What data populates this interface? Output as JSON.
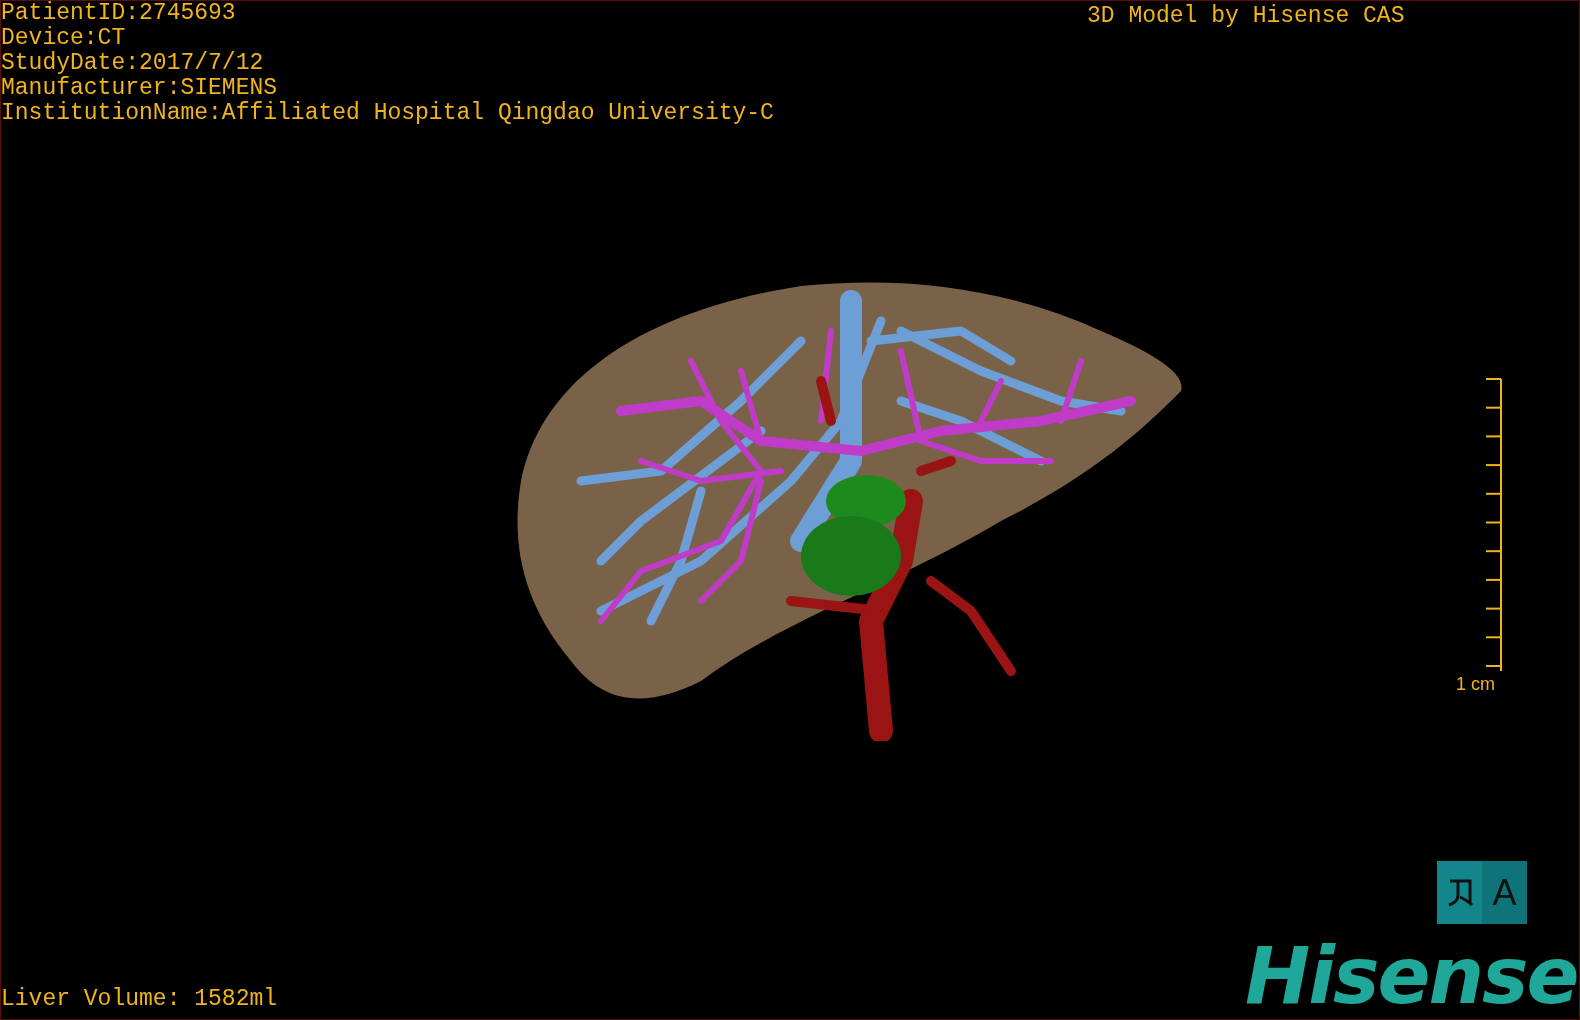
{
  "patient_info": [
    "PatientID:2745693",
    "Device:CT",
    "StudyDate:2017/7/12",
    "Manufacturer:SIEMENS",
    "InstitutionName:Affiliated Hospital Qingdao University-C"
  ],
  "model_credit": "3D Model by Hisense CAS",
  "scale_bar": {
    "label": "1 cm"
  },
  "volume": "Liver Volume: 1582ml",
  "language_button": {
    "label": "A"
  },
  "logo": "Hisense"
}
